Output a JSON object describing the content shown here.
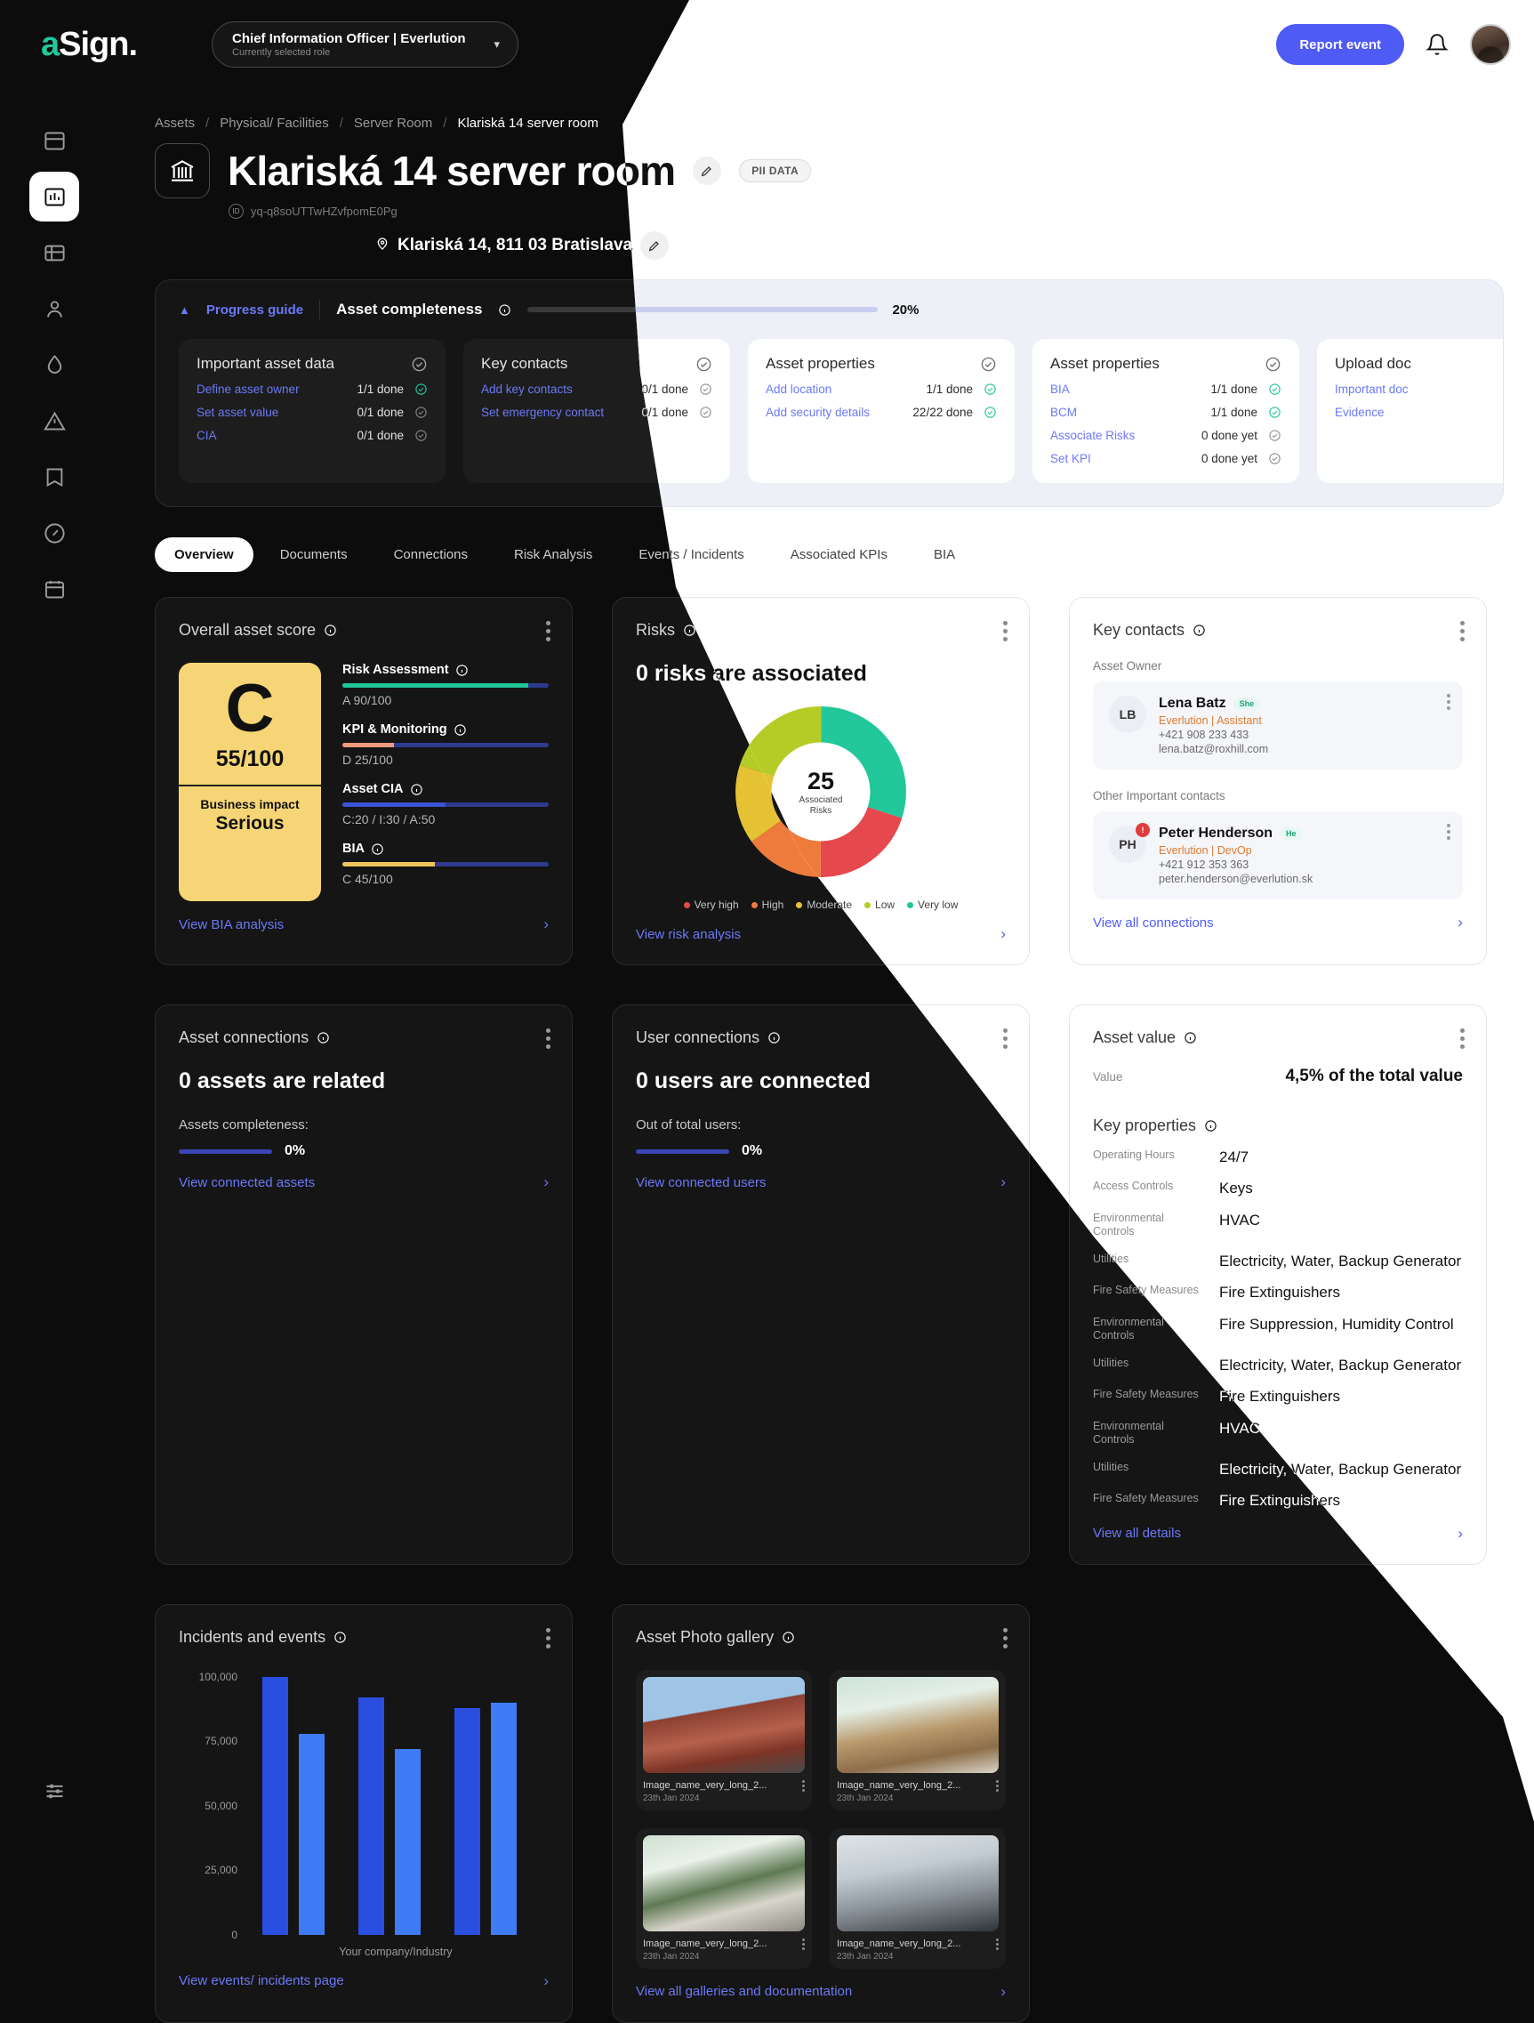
{
  "brand": {
    "logo_a": "a",
    "logo_rest": "Sign."
  },
  "topbar": {
    "role_main": "Chief Information Officer | Everlution",
    "role_sub": "Currently selected role",
    "report_button": "Report event"
  },
  "sidebar": {
    "items": [
      {
        "name": "dashboard-icon"
      },
      {
        "name": "analytics-icon"
      },
      {
        "name": "assets-icon"
      },
      {
        "name": "people-icon"
      },
      {
        "name": "risk-drop-icon"
      },
      {
        "name": "warning-icon"
      },
      {
        "name": "library-icon"
      },
      {
        "name": "gauge-icon"
      },
      {
        "name": "calendar-icon"
      },
      {
        "name": "settings-sliders-icon"
      }
    ]
  },
  "breadcrumb": [
    "Assets",
    "Physical/ Facilities",
    "Server Room",
    "Klariská 14 server room"
  ],
  "header": {
    "title": "Klariská 14 server room",
    "pii_badge": "PII DATA",
    "asset_id": "yq-q8soUTTwHZvfpomE0Pg",
    "address": "Klariská 14, 811 03 Bratislava"
  },
  "progress_guide": {
    "toggle_label": "Progress guide",
    "completeness_label": "Asset completeness",
    "percent": "20%",
    "percent_value": 20,
    "cards": [
      {
        "title": "Important asset data",
        "items": [
          {
            "label": "Define asset owner",
            "count": "1/1 done",
            "done": true
          },
          {
            "label": "Set asset value",
            "count": "0/1 done",
            "done": false
          },
          {
            "label": "CIA",
            "count": "0/1 done",
            "done": false
          }
        ]
      },
      {
        "title": "Key contacts",
        "items": [
          {
            "label": "Add key contacts",
            "count": "0/1 done",
            "done": false
          },
          {
            "label": "Set emergency contact",
            "count": "0/1 done",
            "done": false
          }
        ]
      },
      {
        "title": "Asset properties",
        "items": [
          {
            "label": "Add location",
            "count": "1/1 done",
            "done": true
          },
          {
            "label": "Add security details",
            "count": "22/22 done",
            "done": true
          }
        ]
      },
      {
        "title": "Asset properties",
        "items": [
          {
            "label": "BIA",
            "count": "1/1 done",
            "done": true
          },
          {
            "label": "BCM",
            "count": "1/1 done",
            "done": true
          },
          {
            "label": "Associate Risks",
            "count": "0 done yet",
            "done": false
          },
          {
            "label": "Set KPI",
            "count": "0 done yet",
            "done": false
          }
        ]
      },
      {
        "title": "Upload doc",
        "items": [
          {
            "label": "Important doc",
            "count": "",
            "done": false
          },
          {
            "label": "Evidence",
            "count": "",
            "done": false
          }
        ]
      }
    ]
  },
  "tabs": [
    {
      "label": "Overview",
      "active": true
    },
    {
      "label": "Documents",
      "active": false
    },
    {
      "label": "Connections",
      "active": false
    },
    {
      "label": "Risk Analysis",
      "active": false
    },
    {
      "label": "Events / Incidents",
      "active": false
    },
    {
      "label": "Associated KPIs",
      "active": false
    },
    {
      "label": "BIA",
      "active": false
    }
  ],
  "asset_score": {
    "title": "Overall asset score",
    "grade": "C",
    "score": "55/100",
    "impact_label": "Business impact",
    "impact_value": "Serious",
    "metrics": [
      {
        "label": "Risk Assessment",
        "value": "A 90/100",
        "pct": 90,
        "color": "#21c79a"
      },
      {
        "label": "KPI & Monitoring",
        "value": "D 25/100",
        "pct": 25,
        "color": "#f0997c"
      },
      {
        "label": "Asset CIA",
        "value": "C:20 / I:30 / A:50",
        "pct": 50,
        "color": "#3b53d6"
      },
      {
        "label": "BIA",
        "value": "C 45/100",
        "pct": 45,
        "color": "#f0c65c"
      }
    ],
    "link": "View BIA analysis"
  },
  "risks": {
    "title": "Risks",
    "headline": "0 risks are associated",
    "center_number": "25",
    "center_label": "Associated\nRisks",
    "link": "View risk analysis",
    "legend": [
      {
        "label": "Very high",
        "color": "#e5484d"
      },
      {
        "label": "High",
        "color": "#ee7b3c"
      },
      {
        "label": "Moderate",
        "color": "#e5c234"
      },
      {
        "label": "Low",
        "color": "#b5cc26"
      },
      {
        "label": "Very low",
        "color": "#22c79b"
      }
    ]
  },
  "chart_data": {
    "type": "donut",
    "title": "Risks",
    "categories": [
      "Very low",
      "Very high",
      "High",
      "Moderate",
      "Low"
    ],
    "values": [
      30,
      20,
      15,
      15,
      20
    ],
    "colors": [
      "#22c79b",
      "#e5484d",
      "#ee7b3c",
      "#e5c234",
      "#b5cc26"
    ],
    "center_value": 25,
    "center_label": "Associated Risks",
    "legend_position": "bottom"
  },
  "key_contacts": {
    "title": "Key contacts",
    "owner_label": "Asset Owner",
    "other_label": "Other Important contacts",
    "owner": {
      "initials": "LB",
      "name": "Lena Batz",
      "tag": "She",
      "role": "Everlution | Assistant",
      "phone": "+421 908 233 433",
      "email": "lena.batz@roxhill.com"
    },
    "other": {
      "initials": "PH",
      "badge": "!",
      "name": "Peter Henderson",
      "tag": "He",
      "role": "Everlution | DevOp",
      "phone": "+421 912 353 363",
      "email": "peter.henderson@everlution.sk"
    },
    "link": "View all connections"
  },
  "asset_connections": {
    "title": "Asset connections",
    "headline": "0 assets are related",
    "sub": "Assets completeness:",
    "pct": "0%",
    "link": "View connected assets"
  },
  "user_connections": {
    "title": "User connections",
    "headline": "0 users are connected",
    "sub": "Out of total users:",
    "pct": "0%",
    "link": "View connected users"
  },
  "asset_value": {
    "title": "Asset value",
    "value_label": "Value",
    "value": "4,5% of the total value"
  },
  "key_properties": {
    "title": "Key properties",
    "rows": [
      {
        "key": "Operating Hours",
        "value": "24/7"
      },
      {
        "key": "Access Controls",
        "value": "Keys"
      },
      {
        "key": "Environmental Controls",
        "value": "HVAC"
      },
      {
        "key": "Utilities",
        "value": "Electricity, Water, Backup Generator"
      },
      {
        "key": "Fire Safety Measures",
        "value": "Fire Extinguishers"
      },
      {
        "key": "Environmental Controls",
        "value": "Fire Suppression, Humidity Control"
      },
      {
        "key": "Utilities",
        "value": "Electricity, Water, Backup Generator"
      },
      {
        "key": "Fire Safety Measures",
        "value": "Fire Extinguishers"
      },
      {
        "key": "Environmental Controls",
        "value": "HVAC"
      },
      {
        "key": "Utilities",
        "value": "Electricity, Water, Backup Generator"
      },
      {
        "key": "Fire Safety Measures",
        "value": "Fire Extinguishers"
      }
    ],
    "link": "View all details"
  },
  "incidents": {
    "title": "Incidents and events",
    "link": "View events/ incidents page",
    "chart": {
      "type": "bar",
      "ylabel": "",
      "xlabel": "Your company/Industry",
      "yticks": [
        "100,000",
        "75,000",
        "50,000",
        "25,000",
        "0"
      ],
      "ylim": [
        0,
        100000
      ],
      "values": [
        100000,
        78000,
        92000,
        72000,
        88000,
        90000
      ],
      "colors": [
        "#2a4fe0",
        "#3f7bf5",
        "#2a4fe0",
        "#3f7bf5",
        "#2a4fe0",
        "#3f7bf5"
      ]
    }
  },
  "gallery": {
    "title": "Asset Photo gallery",
    "link": "View all galleries and documentation",
    "items": [
      {
        "name": "Image_name_very_long_2...",
        "date": "23th Jan 2024",
        "style": "g1"
      },
      {
        "name": "Image_name_very_long_2...",
        "date": "23th Jan 2024",
        "style": "g2"
      },
      {
        "name": "Image_name_very_long_2...",
        "date": "23th Jan 2024",
        "style": "g3"
      },
      {
        "name": "Image_name_very_long_2...",
        "date": "23th Jan 2024",
        "style": "g4"
      }
    ]
  }
}
